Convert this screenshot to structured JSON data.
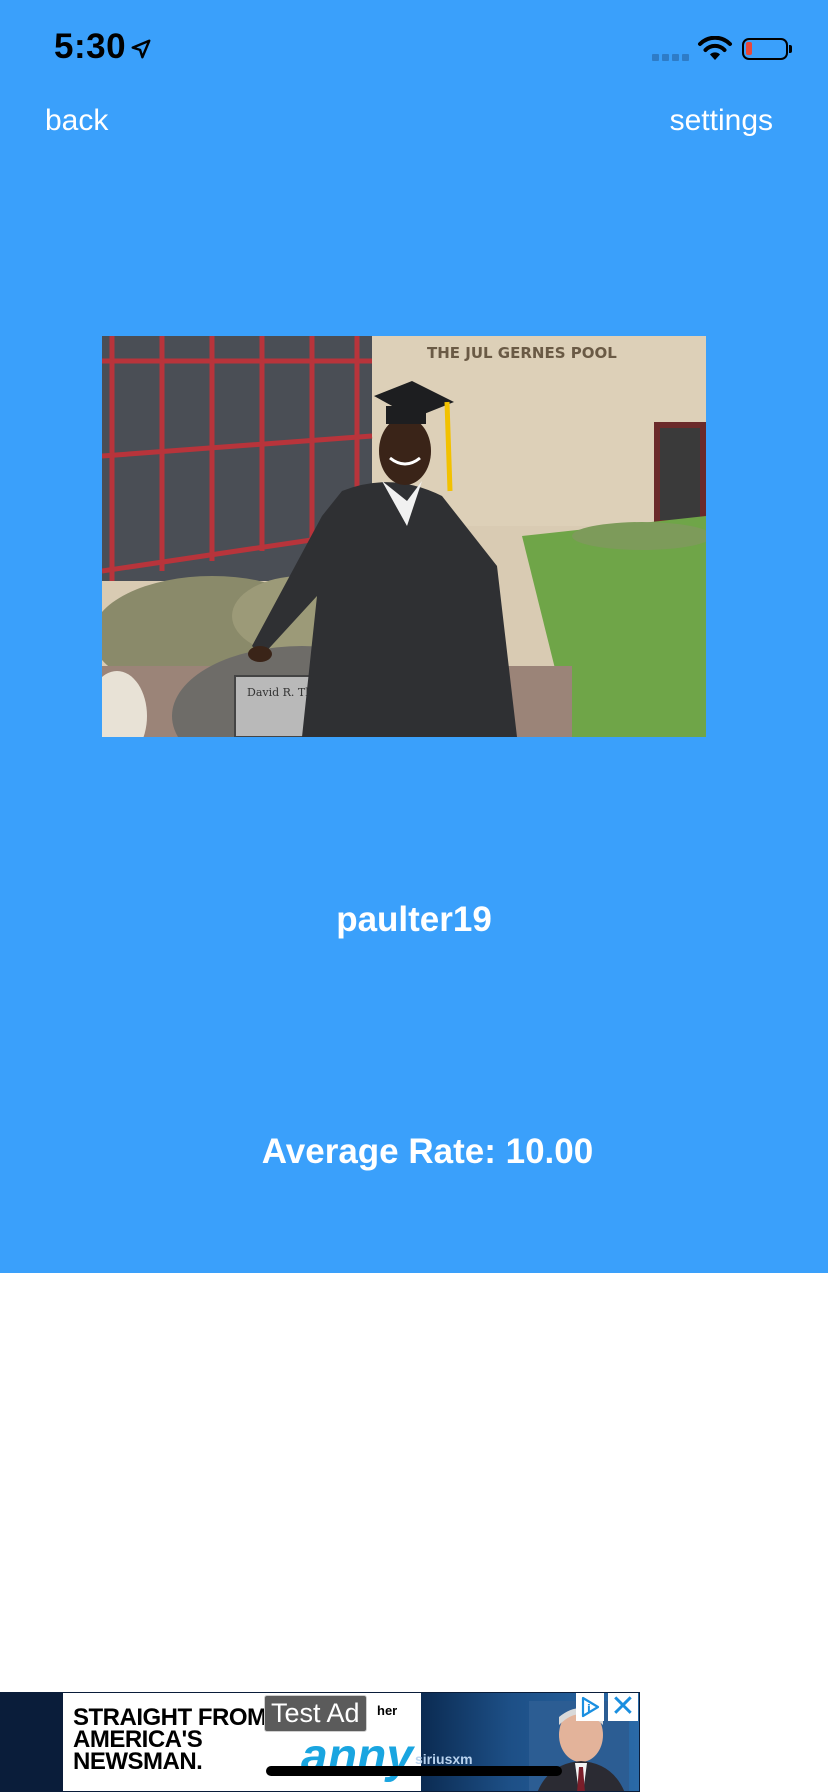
{
  "status_bar": {
    "time": "5:30",
    "battery_level": 0.15
  },
  "nav": {
    "back_label": "back",
    "settings_label": "settings"
  },
  "profile": {
    "username": "paulter19",
    "average_rate": "Average Rate: 10.00"
  },
  "ad": {
    "label": "Test Ad",
    "headline_lines": [
      "STRAIGHT FROM",
      "AMERICA'S",
      "NEWSMAN."
    ],
    "brand_small": "her",
    "brand": "anny",
    "sponsor": "siriusxm",
    "close_symbol": "✕"
  },
  "colors": {
    "panel": "#3aa0fb",
    "background": "#ffffff",
    "text": "#ffffff"
  }
}
